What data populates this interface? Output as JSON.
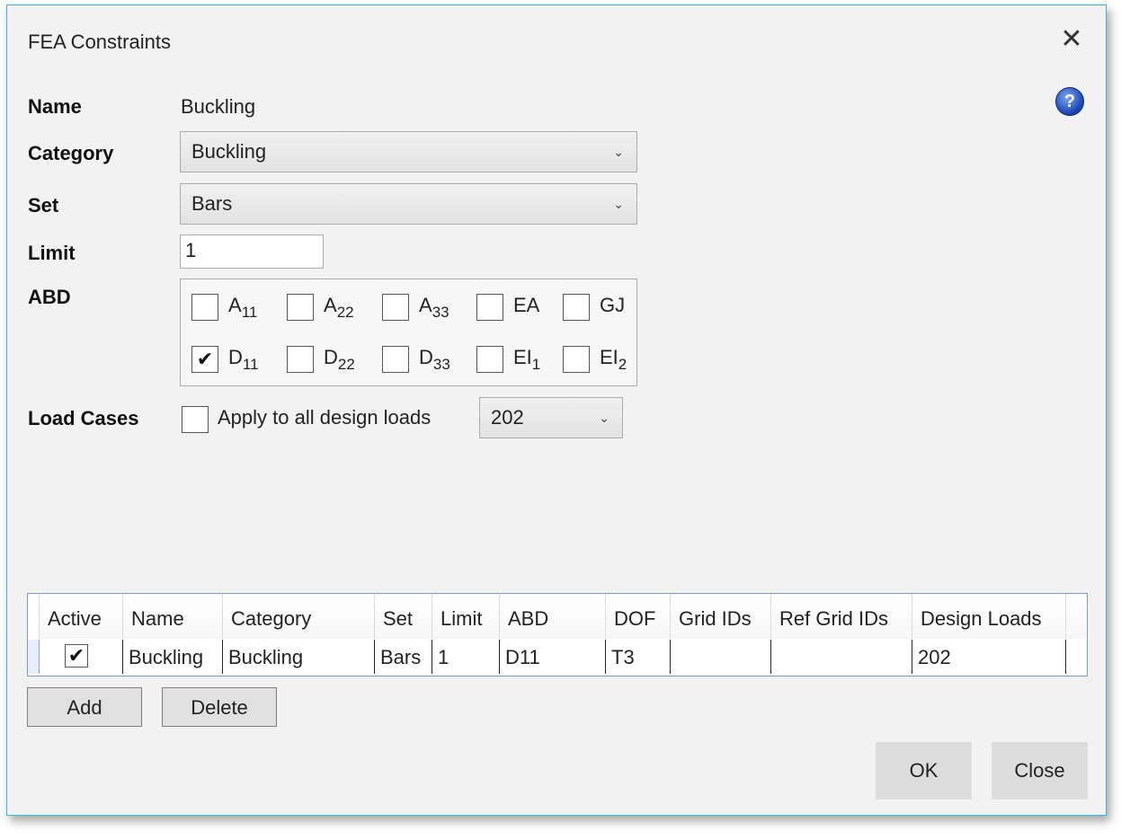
{
  "dialog": {
    "title": "FEA Constraints",
    "close_glyph": "✕",
    "help_glyph": "?"
  },
  "form": {
    "name_label": "Name",
    "name_value": "Buckling",
    "category_label": "Category",
    "category_value": "Buckling",
    "set_label": "Set",
    "set_value": "Bars",
    "limit_label": "Limit",
    "limit_value": "1",
    "abd_label": "ABD",
    "load_cases_label": "Load Cases",
    "apply_all_label": "Apply to all design loads",
    "apply_all_checked": false,
    "load_case_value": "202"
  },
  "abd": {
    "row1": [
      {
        "base": "A",
        "sub": "11",
        "checked": false
      },
      {
        "base": "A",
        "sub": "22",
        "checked": false
      },
      {
        "base": "A",
        "sub": "33",
        "checked": false
      },
      {
        "base": "EA",
        "sub": "",
        "checked": false
      },
      {
        "base": "GJ",
        "sub": "",
        "checked": false
      }
    ],
    "row2": [
      {
        "base": "D",
        "sub": "11",
        "checked": true
      },
      {
        "base": "D",
        "sub": "22",
        "checked": false
      },
      {
        "base": "D",
        "sub": "33",
        "checked": false
      },
      {
        "base": "EI",
        "sub": "1",
        "checked": false
      },
      {
        "base": "EI",
        "sub": "2",
        "checked": false
      }
    ]
  },
  "table": {
    "columns": [
      "Active",
      "Name",
      "Category",
      "Set",
      "Limit",
      "ABD",
      "DOF",
      "Grid IDs",
      "Ref Grid IDs",
      "Design Loads"
    ],
    "rows": [
      {
        "active": true,
        "name": "Buckling",
        "category": "Buckling",
        "set": "Bars",
        "limit": "1",
        "abd": "D11",
        "dof": "T3",
        "grid_ids": "",
        "ref_grid_ids": "",
        "design_loads": "202"
      }
    ]
  },
  "buttons": {
    "add": "Add",
    "delete": "Delete",
    "ok": "OK",
    "close": "Close"
  },
  "glyphs": {
    "check": "✔",
    "chevron": "⌄"
  }
}
